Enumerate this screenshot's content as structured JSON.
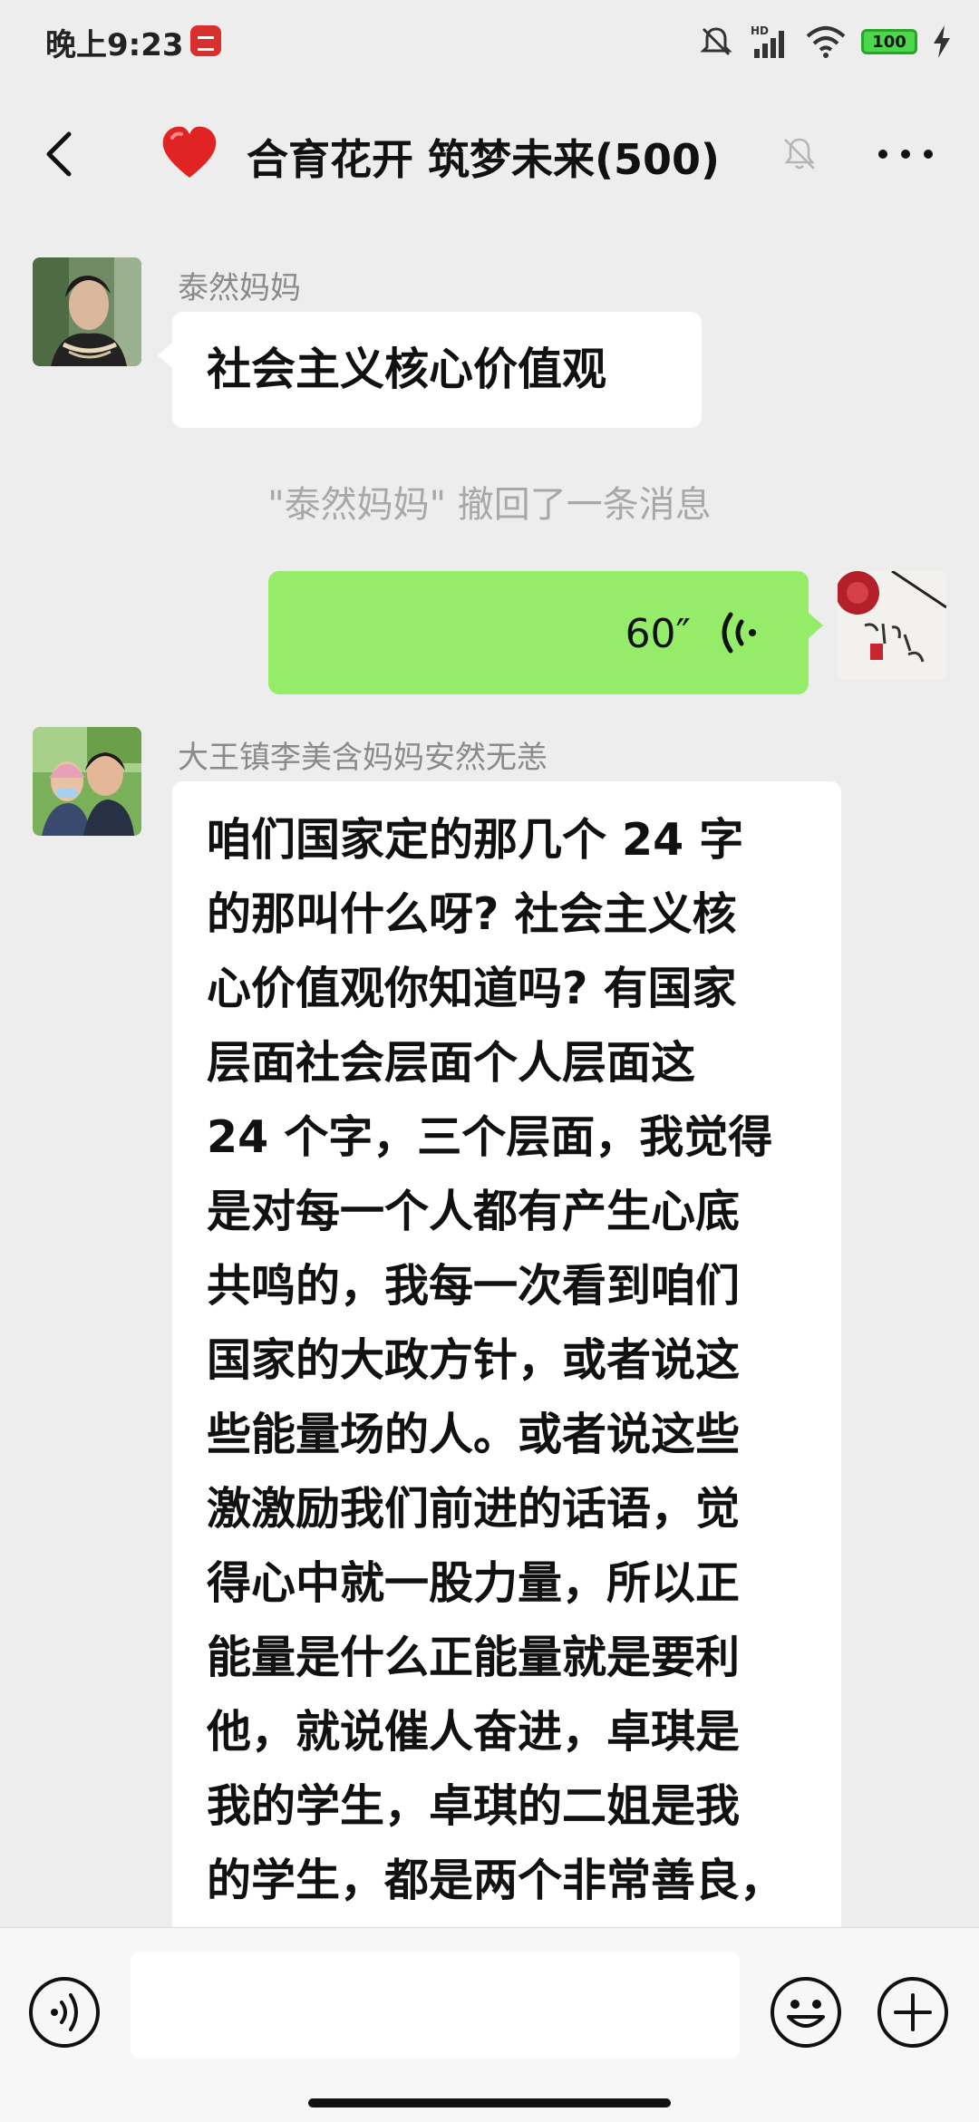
{
  "status_bar": {
    "time": "晚上9:23",
    "battery": "100",
    "network": "HD"
  },
  "header": {
    "title": "合育花开 筑梦未来(500)",
    "emoji": "red-heart",
    "muted": true
  },
  "messages": [
    {
      "type": "text",
      "direction": "incoming",
      "sender": "泰然妈妈",
      "text": "社会主义核心价值观"
    },
    {
      "type": "system",
      "text": "\"泰然妈妈\" 撤回了一条消息"
    },
    {
      "type": "voice",
      "direction": "outgoing",
      "duration": "60″"
    },
    {
      "type": "text",
      "direction": "incoming",
      "sender": "大王镇李美含妈妈安然无恙",
      "lines": [
        "咱们国家定的那几个 24 字",
        "的那叫什么呀? 社会主义核",
        "心价值观你知道吗? 有国家",
        "层面社会层面个人层面这",
        "24 个字，三个层面，我觉得",
        "是对每一个人都有产生心底",
        "共鸣的，我每一次看到咱们",
        "国家的大政方针，或者说这",
        "些能量场的人。或者说这些",
        "激激励我们前进的话语，觉",
        "得心中就一股力量，所以正",
        "能量是什么正能量就是要利",
        "他，就说催人奋进，卓琪是",
        "我的学生，卓琪的二姐是我",
        "的学生，都是两个非常善良，"
      ]
    }
  ],
  "input_bar": {
    "value": "",
    "placeholder": ""
  },
  "colors": {
    "background": "#ededed",
    "outgoing_bubble": "#95ec69",
    "incoming_bubble": "#ffffff",
    "accent_red": "#e02424"
  }
}
